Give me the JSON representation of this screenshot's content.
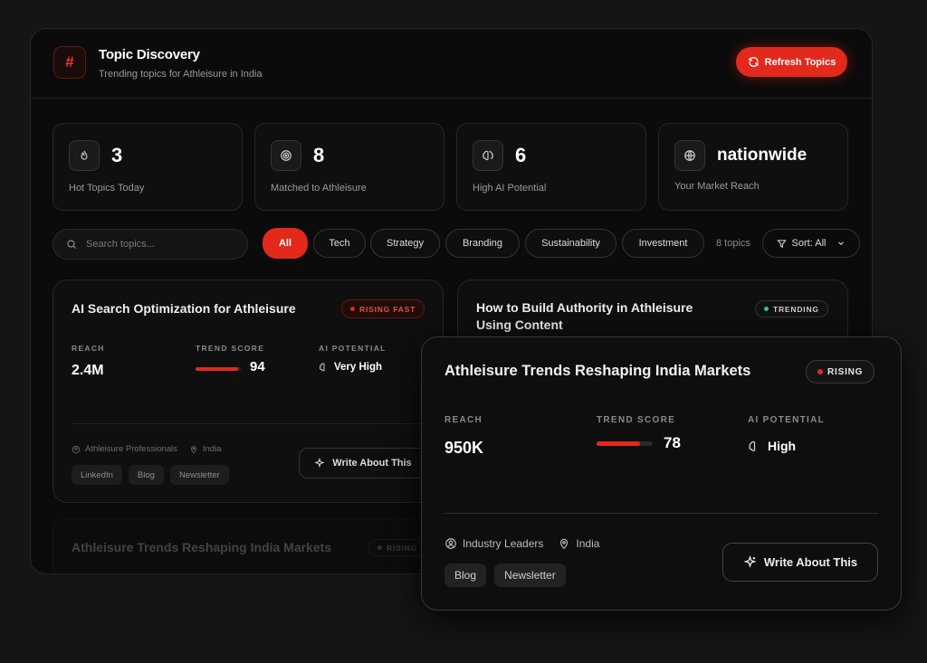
{
  "header": {
    "logo_glyph": "#",
    "title": "Topic Discovery",
    "subtitle": "Trending topics for Athleisure in India",
    "refresh_label": "Refresh Topics"
  },
  "stats": [
    {
      "value": "3",
      "label": "Hot Topics Today",
      "icon": "flame-icon"
    },
    {
      "value": "8",
      "label": "Matched to Athleisure",
      "icon": "target-icon"
    },
    {
      "value": "6",
      "label": "High AI Potential",
      "icon": "brain-icon"
    },
    {
      "value": "nationwide",
      "label": "Your Market Reach",
      "icon": "globe-icon"
    }
  ],
  "search": {
    "placeholder": "Search topics..."
  },
  "filters": [
    "All",
    "Tech",
    "Strategy",
    "Branding",
    "Sustainability",
    "Investment"
  ],
  "topic_count": "8 topics",
  "sort_label": "Sort: All",
  "labels": {
    "reach": "REACH",
    "trend_score": "TREND SCORE",
    "ai_potential": "AI POTENTIAL",
    "write": "Write About This"
  },
  "cards": [
    {
      "title": "AI Search Optimization for Athleisure",
      "badge": "RISING FAST",
      "reach": "2.4M",
      "trend_score": "94",
      "trend_fraction": 0.94,
      "ai_potential": "Very High",
      "audience": "Athleisure Professionals",
      "location": "India",
      "tags": [
        "LinkedIn",
        "Blog",
        "Newsletter"
      ]
    },
    {
      "title": "How to Build Authority in Athleisure Using Content",
      "badge": "TRENDING"
    },
    {
      "title": "Athleisure Trends Reshaping India Markets",
      "badge": "RISING"
    }
  ],
  "featured": {
    "title": "Athleisure Trends Reshaping India Markets",
    "badge": "RISING",
    "reach": "950K",
    "trend_score": "78",
    "trend_fraction": 0.78,
    "ai_potential": "High",
    "audience": "Industry Leaders",
    "location": "India",
    "tags": [
      "Blog",
      "Newsletter"
    ]
  },
  "colors": {
    "accent": "#e3291c",
    "trending": "#2ecc71",
    "background": "#0b0b0b"
  }
}
